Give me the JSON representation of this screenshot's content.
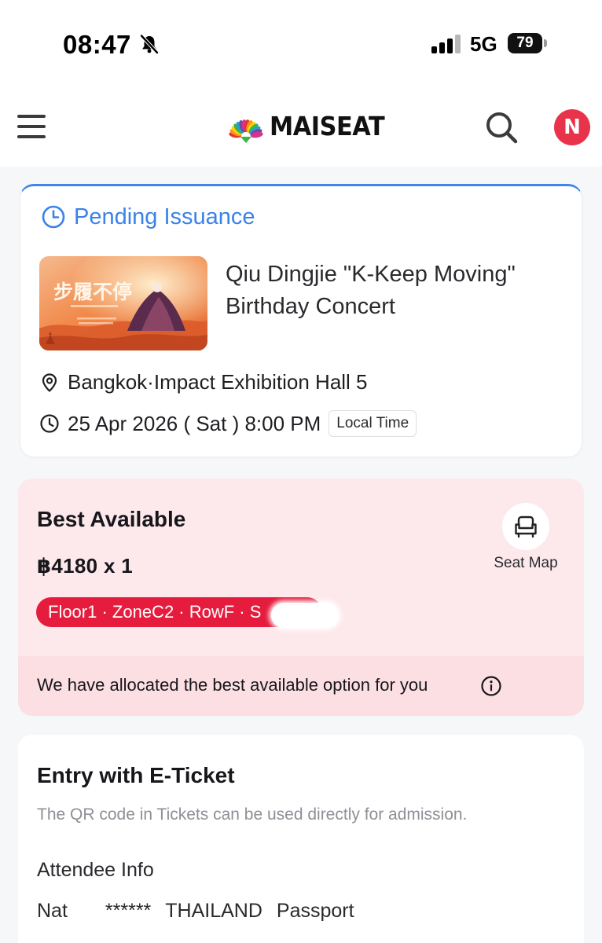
{
  "status_bar": {
    "time": "08:47",
    "network": "5G",
    "battery": "79"
  },
  "header": {
    "brand": "MAISEAT",
    "avatar_initial": "N",
    "brand_colors": [
      "#e7332f",
      "#f7941d",
      "#ffd200",
      "#3ab54a",
      "#2e9bd6",
      "#6a4ca3",
      "#d6338f"
    ]
  },
  "event_card": {
    "status": "Pending Issuance",
    "status_color": "#3b82e8",
    "title_line1": "Qiu Dingjie \"K-Keep Moving\"",
    "title_line2": "Birthday Concert",
    "location": "Bangkok·Impact Exhibition Hall 5",
    "datetime": "25 Apr 2026 ( Sat ) 8:00 PM",
    "timezone_badge": "Local Time",
    "poster_text": "步履不停"
  },
  "seat_card": {
    "heading": "Best Available",
    "price": "฿4180 x 1",
    "seat_info": "Floor1 · ZoneC2 · RowF · S",
    "seat_map_label": "Seat Map",
    "note": "We have allocated the best available option for you",
    "chip_color": "#e51c3d"
  },
  "entry_card": {
    "title": "Entry with E-Ticket",
    "subtitle": "The QR code in Tickets can be used directly for admission.",
    "attendee_heading": "Attendee Info",
    "attendee_name": "Nat",
    "attendee_masked": "******",
    "attendee_country": "THAILAND",
    "attendee_doc": "Passport"
  }
}
